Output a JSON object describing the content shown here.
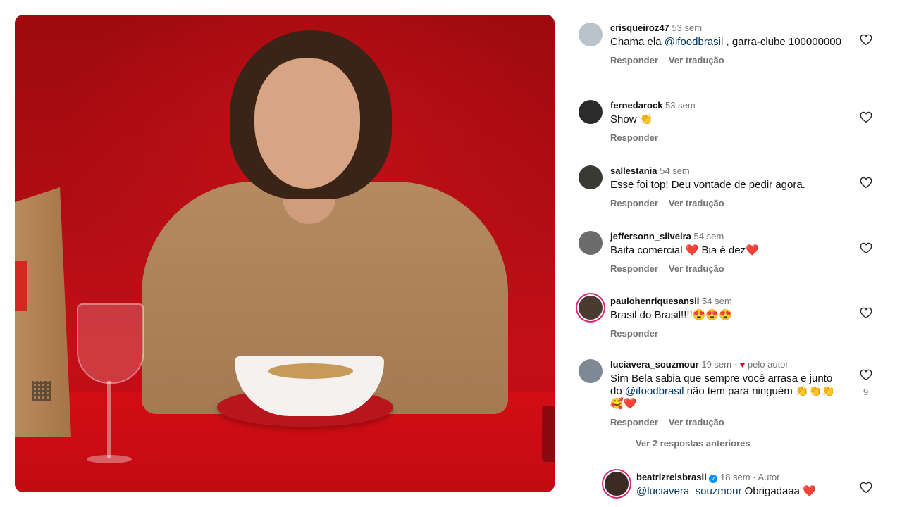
{
  "comments": [
    {
      "user": "crisqueiroz47",
      "time": "53 sem",
      "text_before": "Chama ela ",
      "mention": "@ifoodbrasil",
      "text_after": " , garra-clube 100000000",
      "reply": "Responder",
      "translate": "Ver tradução"
    },
    {
      "user": "fernedarock",
      "time": "53 sem",
      "text": "Show 👏",
      "reply": "Responder"
    },
    {
      "user": "sallestania",
      "time": "54 sem",
      "text": "Esse foi top! Deu vontade de pedir agora.",
      "reply": "Responder",
      "translate": "Ver tradução"
    },
    {
      "user": "jeffersonn_silveira",
      "time": "54 sem",
      "text": "Baita comercial ❤️ Bia é dez❤️",
      "reply": "Responder",
      "translate": "Ver tradução"
    },
    {
      "user": "paulohenriquesansil",
      "time": "54 sem",
      "text": "Brasil do Brasil!!!!😍😍😍",
      "reply": "Responder"
    },
    {
      "user": "luciavera_souzmour",
      "time": "19 sem",
      "liked_by_author": "pelo autor",
      "text_before": "Sim Bela sabia que sempre você arrasa e junto do ",
      "mention": "@ifoodbrasil",
      "text_after": " não tem para ninguém 👏👏👏🥰❤️",
      "reply": "Responder",
      "translate": "Ver tradução",
      "likes": "9"
    },
    {
      "user": "beatrizreisbrasil",
      "time": "18 sem",
      "badge": "Autor",
      "mention": "@luciavera_souzmour",
      "text_after": " Obrigadaaa ❤️"
    }
  ],
  "view_replies": "Ver 2 respostas anteriores",
  "colors": {
    "accent_red": "#e0001b",
    "muted": "#737373",
    "mention": "#00376b"
  }
}
